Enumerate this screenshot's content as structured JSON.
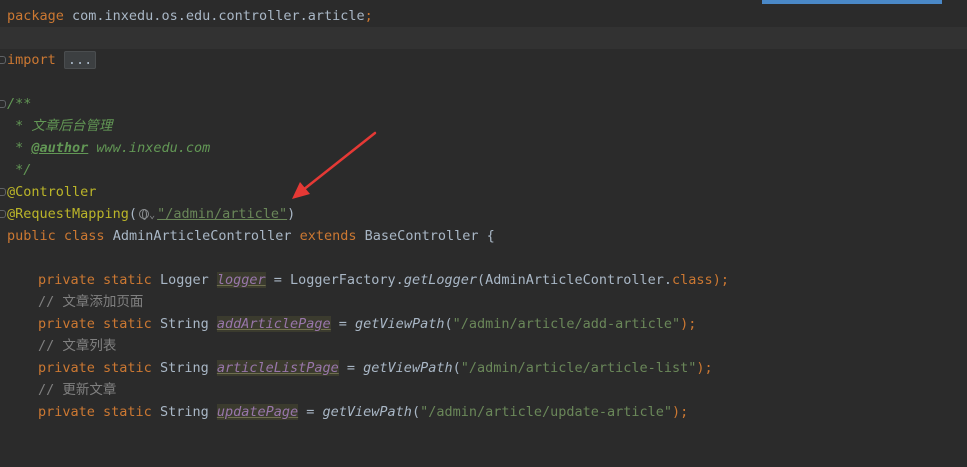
{
  "editor": {
    "accent_color": "#cc7832",
    "arrow_color": "#e53935",
    "lines": {
      "l1": {
        "package_kw": "package",
        "package_name": " com.inxedu.os.edu.controller.article",
        "semi": ";"
      },
      "l3": {
        "import_kw": "import",
        "folded": "..."
      },
      "l5": {
        "text": "/**"
      },
      "l6": {
        "text": " * 文章后台管理"
      },
      "l7": {
        "star": " * ",
        "tag": "@author",
        "rest": " www.inxedu.com"
      },
      "l8": {
        "text": " */"
      },
      "l9": {
        "annotation": "@Controller"
      },
      "l10": {
        "annotation": "@RequestMapping",
        "open": "(",
        "chevron": "⌄",
        "value": "\"/admin/article\"",
        "close": ")"
      },
      "l11": {
        "public": "public",
        "class": "class",
        "name": " AdminArticleController ",
        "extends": "extends",
        "base": " BaseController {"
      },
      "l13": {
        "private": "private",
        "static": "static",
        "type": " Logger ",
        "field": "logger",
        "eq": " = LoggerFactory.",
        "method": "getLogger",
        "args": "(AdminArticleController.",
        "kw_class": "class",
        "end": ");"
      },
      "l14": {
        "comment": "// 文章添加页面"
      },
      "l15": {
        "private": "private",
        "static": "static",
        "type": " String ",
        "field": "addArticlePage",
        "eq": " = ",
        "method": "getViewPath",
        "open": "(",
        "value": "\"/admin/article/add-article\"",
        "end": ");"
      },
      "l16": {
        "comment": "// 文章列表"
      },
      "l17": {
        "private": "private",
        "static": "static",
        "type": " String ",
        "field": "articleListPage",
        "eq": " = ",
        "method": "getViewPath",
        "open": "(",
        "value": "\"/admin/article/article-list\"",
        "end": ");"
      },
      "l18": {
        "comment": "// 更新文章"
      },
      "l19": {
        "private": "private",
        "static": "static",
        "type": " String ",
        "field": "updatePage",
        "eq": " = ",
        "method": "getViewPath",
        "open": "(",
        "value": "\"/admin/article/update-article\"",
        "end": ");"
      }
    }
  }
}
